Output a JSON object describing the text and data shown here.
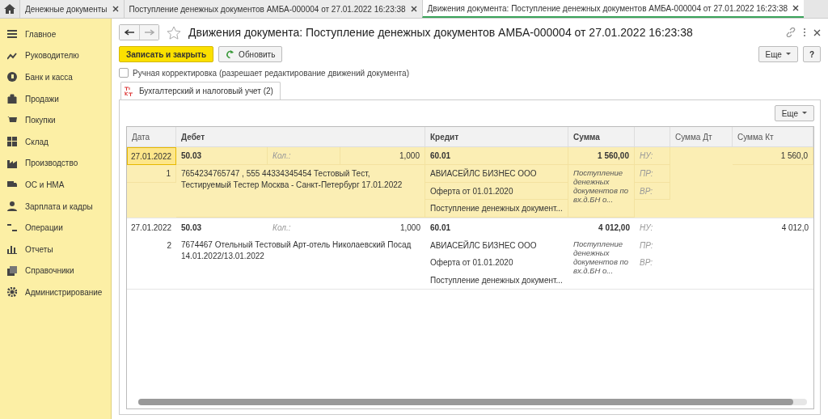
{
  "tabs": [
    {
      "label": "Денежные документы",
      "selected": false
    },
    {
      "label": "Поступление денежных документов АМБА-000004 от 27.01.2022 16:23:38",
      "selected": false
    },
    {
      "label": "Движения документа: Поступление денежных документов АМБА-000004 от 27.01.2022 16:23:38",
      "selected": true
    }
  ],
  "sidebar": {
    "items": [
      {
        "label": "Главное"
      },
      {
        "label": "Руководителю"
      },
      {
        "label": "Банк и касса"
      },
      {
        "label": "Продажи"
      },
      {
        "label": "Покупки"
      },
      {
        "label": "Склад"
      },
      {
        "label": "Производство"
      },
      {
        "label": "ОС и НМА"
      },
      {
        "label": "Зарплата и кадры"
      },
      {
        "label": "Операции"
      },
      {
        "label": "Отчеты"
      },
      {
        "label": "Справочники"
      },
      {
        "label": "Администрирование"
      }
    ]
  },
  "window": {
    "title": "Движения документа: Поступление денежных документов АМБА-000004 от 27.01.2022 16:23:38"
  },
  "toolbar": {
    "save_button": "Записать и закрыть",
    "refresh_button": "Обновить",
    "more_button": "Еще",
    "help_button": "?"
  },
  "manual_edit": {
    "label": "Ручная корректировка (разрешает редактирование движений документа)",
    "checked": false
  },
  "register_tabs": [
    {
      "label": "Бухгалтерский и налоговый учет (2)",
      "selected": true
    }
  ],
  "table_more_button": "Еще",
  "table": {
    "columns": [
      "Дата",
      "Дебет",
      "Кредит",
      "Сумма",
      "Сумма Дт",
      "Сумма Кт"
    ],
    "rows": [
      {
        "selected": true,
        "date": "27.01.2022",
        "number": "1",
        "debit_account": "50.03",
        "quantity_label": "Кол.:",
        "quantity": "1,000",
        "debit_description": "7654234765747 , 555 44334345454 Тестовый Тест, Тестируемый Тестер Москва - Санкт-Петербург 17.01.2022",
        "credit_account": "60.01",
        "credit_subconto": [
          "АВИАСЕЙЛС БИЗНЕС ООО",
          "Оферта от 01.01.2020",
          "Поступление денежных документ..."
        ],
        "amount": "1 560,00",
        "amount_description": "Поступление денежных документов по вх.д.БН о...",
        "tax_labels": [
          "НУ:",
          "ПР:",
          "ВР:"
        ],
        "amount_kt": "1 560,0"
      },
      {
        "selected": false,
        "date": "27.01.2022",
        "number": "2",
        "debit_account": "50.03",
        "quantity_label": "Кол.:",
        "quantity": "1,000",
        "debit_description": "7674467 Отельный Тестовый Арт-отель Николаевский Посад 14.01.2022/13.01.2022",
        "credit_account": "60.01",
        "credit_subconto": [
          "АВИАСЕЙЛС БИЗНЕС ООО",
          "Оферта от 01.01.2020",
          "Поступление денежных документ..."
        ],
        "amount": "4 012,00",
        "amount_description": "Поступление денежных документов по вх.д.БН о...",
        "tax_labels": [
          "НУ:",
          "ПР:",
          "ВР:"
        ],
        "amount_kt": "4 012,0"
      }
    ]
  }
}
